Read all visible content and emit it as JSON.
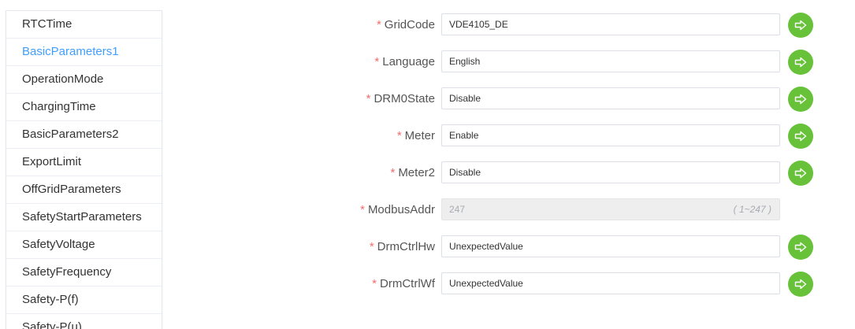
{
  "sidebar": {
    "items": [
      {
        "label": "RTCTime",
        "active": false
      },
      {
        "label": "BasicParameters1",
        "active": true
      },
      {
        "label": "OperationMode",
        "active": false
      },
      {
        "label": "ChargingTime",
        "active": false
      },
      {
        "label": "BasicParameters2",
        "active": false
      },
      {
        "label": "ExportLimit",
        "active": false
      },
      {
        "label": "OffGridParameters",
        "active": false
      },
      {
        "label": "SafetyStartParameters",
        "active": false
      },
      {
        "label": "SafetyVoltage",
        "active": false
      },
      {
        "label": "SafetyFrequency",
        "active": false
      },
      {
        "label": "Safety-P(f)",
        "active": false
      },
      {
        "label": "Safety-P(u)",
        "active": false
      }
    ]
  },
  "form": {
    "required_mark": "*",
    "fields": [
      {
        "label": "GridCode",
        "value": "VDE4105_DE"
      },
      {
        "label": "Language",
        "value": "English"
      },
      {
        "label": "DRM0State",
        "value": "Disable"
      },
      {
        "label": "Meter",
        "value": "Enable"
      },
      {
        "label": "Meter2",
        "value": "Disable"
      },
      {
        "label": "ModbusAddr",
        "value": "247",
        "hint": "( 1~247 )"
      },
      {
        "label": "DrmCtrlHw",
        "value": "UnexpectedValue"
      },
      {
        "label": "DrmCtrlWf",
        "value": "UnexpectedValue"
      }
    ]
  },
  "colors": {
    "accent": "#409eff",
    "submit_button": "#67c23a",
    "required": "#f56c6c"
  },
  "icons": {
    "submit": "arrow-right-icon"
  }
}
